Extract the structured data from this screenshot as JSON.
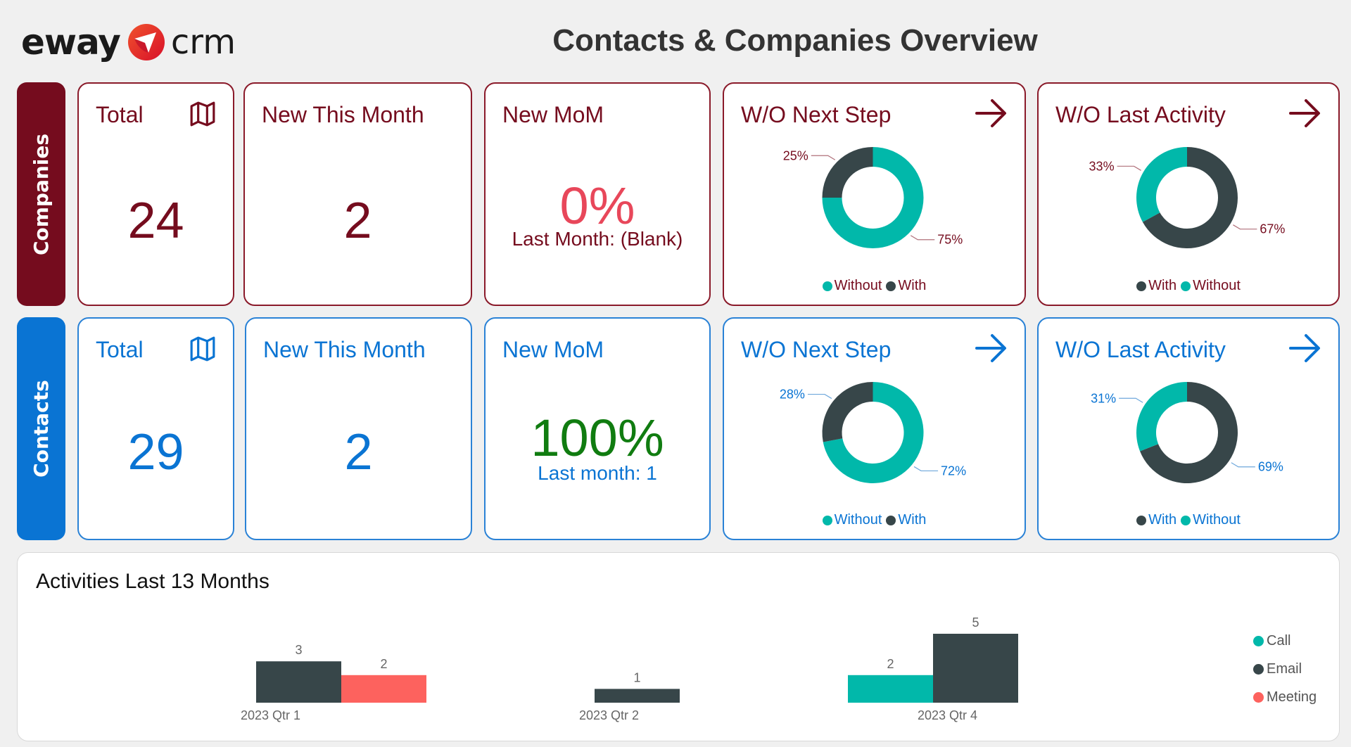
{
  "header": {
    "logo_left": "eway",
    "logo_right": "crm",
    "title": "Contacts & Companies Overview"
  },
  "colors": {
    "companies": "#750c1e",
    "contacts": "#0a74d3",
    "teal": "#01b8aa",
    "dark": "#374649",
    "meeting": "#fd625e",
    "mom_negative": "#e8475a",
    "mom_positive": "#107c10"
  },
  "companies": {
    "side_label": "Companies",
    "total": {
      "label": "Total",
      "value": "24",
      "icon": "map-icon"
    },
    "new_this_month": {
      "label": "New This Month",
      "value": "2"
    },
    "new_mom": {
      "label": "New MoM",
      "value": "0%",
      "sub": "Last Month: (Blank)"
    },
    "wo_next_step": {
      "label": "W/O Next Step",
      "icon": "arrow-right-icon",
      "slices": [
        {
          "name": "With",
          "pct": 25,
          "label": "25%",
          "color": "#374649"
        },
        {
          "name": "Without",
          "pct": 75,
          "label": "75%",
          "color": "#01b8aa"
        }
      ],
      "legend": [
        {
          "name": "Without",
          "color": "#01b8aa"
        },
        {
          "name": "With",
          "color": "#374649"
        }
      ]
    },
    "wo_last_activity": {
      "label": "W/O Last Activity",
      "icon": "arrow-right-icon",
      "slices": [
        {
          "name": "With",
          "pct": 67,
          "label": "67%",
          "color": "#374649"
        },
        {
          "name": "Without",
          "pct": 33,
          "label": "33%",
          "color": "#01b8aa"
        }
      ],
      "legend": [
        {
          "name": "With",
          "color": "#374649"
        },
        {
          "name": "Without",
          "color": "#01b8aa"
        }
      ]
    }
  },
  "contacts": {
    "side_label": "Contacts",
    "total": {
      "label": "Total",
      "value": "29",
      "icon": "map-icon"
    },
    "new_this_month": {
      "label": "New This Month",
      "value": "2"
    },
    "new_mom": {
      "label": "New MoM",
      "value": "100%",
      "sub": "Last month: 1"
    },
    "wo_next_step": {
      "label": "W/O Next Step",
      "icon": "arrow-right-icon",
      "slices": [
        {
          "name": "With",
          "pct": 28,
          "label": "28%",
          "color": "#374649"
        },
        {
          "name": "Without",
          "pct": 72,
          "label": "72%",
          "color": "#01b8aa"
        }
      ],
      "legend": [
        {
          "name": "Without",
          "color": "#01b8aa"
        },
        {
          "name": "With",
          "color": "#374649"
        }
      ]
    },
    "wo_last_activity": {
      "label": "W/O Last Activity",
      "icon": "arrow-right-icon",
      "slices": [
        {
          "name": "With",
          "pct": 69,
          "label": "69%",
          "color": "#374649"
        },
        {
          "name": "Without",
          "pct": 31,
          "label": "31%",
          "color": "#01b8aa"
        }
      ],
      "legend": [
        {
          "name": "With",
          "color": "#374649"
        },
        {
          "name": "Without",
          "color": "#01b8aa"
        }
      ]
    }
  },
  "activities": {
    "title": "Activities Last 13 Months"
  },
  "chart_data": {
    "type": "bar",
    "title": "Activities Last 13 Months",
    "xlabel": "",
    "ylabel": "",
    "categories": [
      "2023 Qtr 1",
      "2023 Qtr 2",
      "2023 Qtr 4"
    ],
    "series": [
      {
        "name": "Call",
        "color": "#01b8aa",
        "values": [
          null,
          null,
          2
        ]
      },
      {
        "name": "Email",
        "color": "#374649",
        "values": [
          3,
          1,
          5
        ]
      },
      {
        "name": "Meeting",
        "color": "#fd625e",
        "values": [
          2,
          null,
          null
        ]
      }
    ],
    "ylim": [
      0,
      5
    ],
    "grid": false,
    "data_labels": true,
    "legend": "right"
  }
}
